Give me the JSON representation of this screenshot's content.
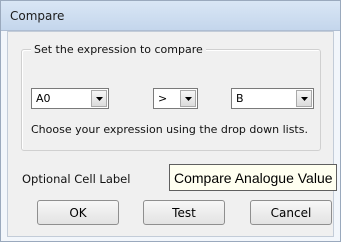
{
  "window": {
    "title": "Compare"
  },
  "expression_group": {
    "legend": "Set the expression to compare",
    "left_operand": {
      "selected": "A0"
    },
    "operator": {
      "selected": ">"
    },
    "right_operand": {
      "selected": "B"
    },
    "hint": "Choose your expression using the drop down lists."
  },
  "cell_label": {
    "label": "Optional Cell Label",
    "value": "Compare Analogue Value"
  },
  "buttons": {
    "ok": "OK",
    "test": "Test",
    "cancel": "Cancel"
  },
  "icons": {
    "dropdown": "chevron-down-icon"
  }
}
